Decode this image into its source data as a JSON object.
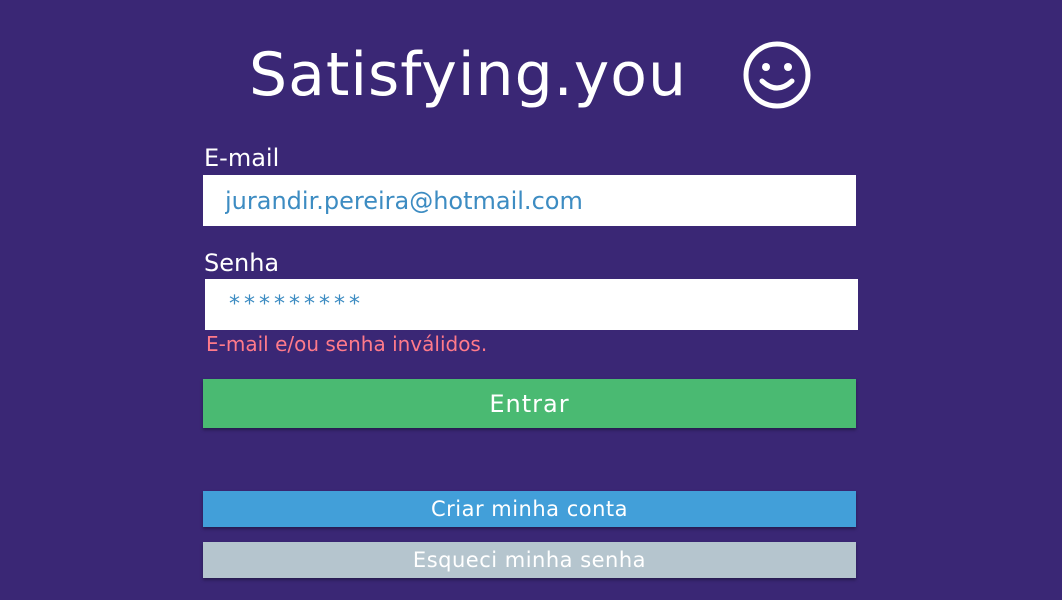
{
  "app": {
    "title": "Satisfying.you",
    "logo_icon": "smiley-face-icon"
  },
  "form": {
    "email_label": "E-mail",
    "email_value": "jurandir.pereira@hotmail.com",
    "password_label": "Senha",
    "password_value": "*********",
    "error_message": "E-mail e/ou senha inválidos."
  },
  "buttons": {
    "enter_label": "Entrar",
    "create_account_label": "Criar minha conta",
    "forgot_password_label": "Esqueci minha senha"
  },
  "colors": {
    "background": "#3a2775",
    "input_text": "#3d8cc2",
    "error": "#ff7a8a",
    "enter_button": "#4aba72",
    "create_button": "#429fd9",
    "forgot_button": "#b5c5ce"
  }
}
